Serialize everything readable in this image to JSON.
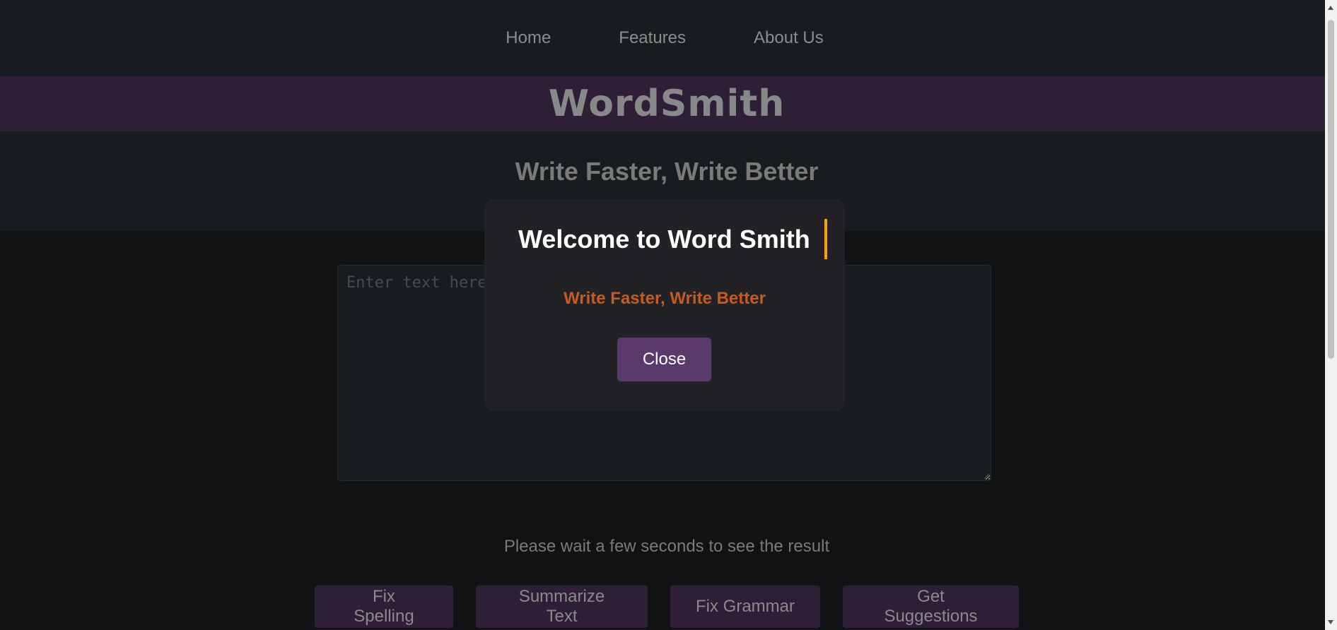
{
  "nav": {
    "items": [
      {
        "label": "Home"
      },
      {
        "label": "Features"
      },
      {
        "label": "About Us"
      }
    ]
  },
  "brand": {
    "title": "WordSmith"
  },
  "hero": {
    "tagline": "Write Faster, Write Better"
  },
  "editor": {
    "placeholder": "Enter text here",
    "value": ""
  },
  "status": {
    "message": "Please wait a few seconds to see the result"
  },
  "actions": {
    "fix_spelling": "Fix Spelling",
    "summarize": "Summarize Text",
    "fix_grammar": "Fix Grammar",
    "suggestions": "Get Suggestions"
  },
  "modal": {
    "title": "Welcome to Word Smith",
    "subtitle": "Write Faster, Write Better",
    "close_label": "Close"
  },
  "colors": {
    "accent": "#5a3a6a",
    "brand_band": "#2e1f37",
    "subtitle": "#c85a1c",
    "cursor": "#f5a10a"
  }
}
